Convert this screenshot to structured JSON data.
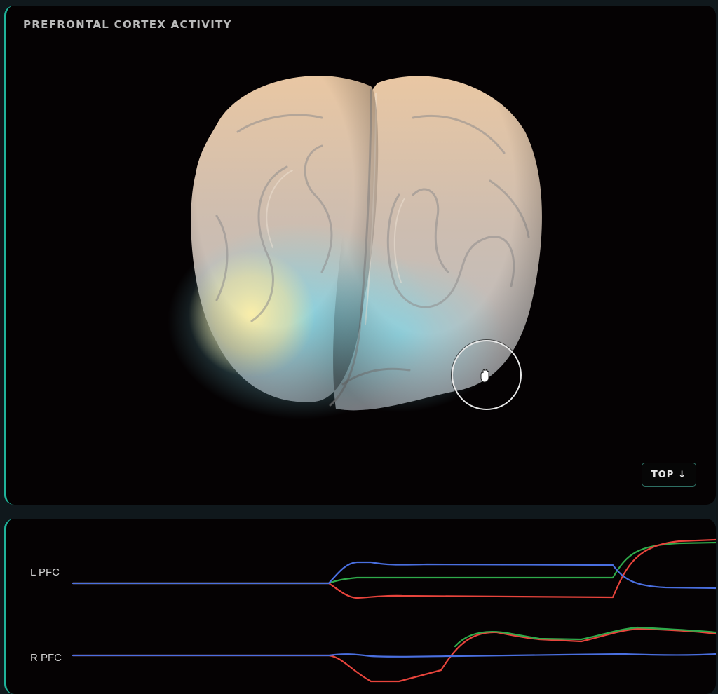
{
  "viewer": {
    "title": "PREFRONTAL CORTEX ACTIVITY",
    "top_button_label": "TOP",
    "top_button_icon": "arrow-down-icon",
    "cursor_icon": "grab-hand-icon"
  },
  "signals": {
    "rows": [
      {
        "label": "L PFC"
      },
      {
        "label": "R PFC"
      }
    ],
    "colors": {
      "blue": "#4a6fe0",
      "green": "#2faa4a",
      "red": "#e8443c"
    }
  },
  "theme": {
    "panel_bg": "#050203",
    "page_bg": "#10181c",
    "accent": "#1fb39a"
  }
}
